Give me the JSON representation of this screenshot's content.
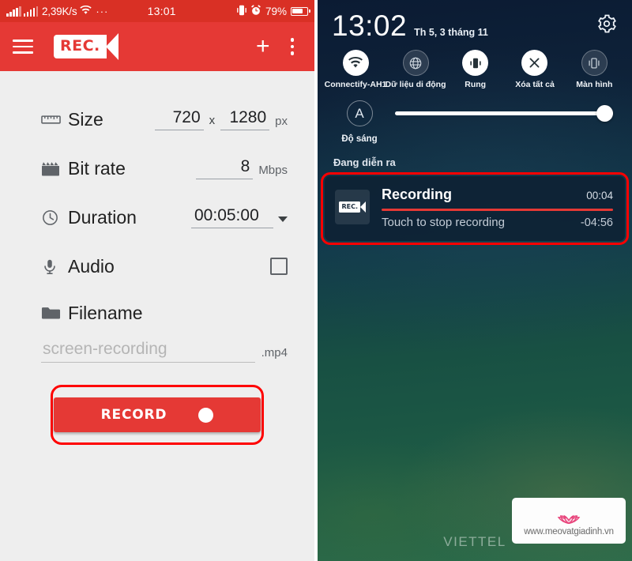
{
  "left": {
    "statusbar": {
      "net_speed": "2,39K/s",
      "dots": "···",
      "time": "13:01",
      "battery_pct": "79%"
    },
    "appbar": {
      "logo_text": "REC.",
      "menu_icon": "hamburger-icon",
      "add_icon": "plus-icon",
      "overflow_icon": "kebab-icon"
    },
    "rows": {
      "size": {
        "label": "Size",
        "icon": "ruler-icon",
        "width": "720",
        "separator": "x",
        "height": "1280",
        "unit": "px"
      },
      "bitrate": {
        "label": "Bit rate",
        "icon": "clapperboard-icon",
        "value": "8",
        "unit": "Mbps"
      },
      "duration": {
        "label": "Duration",
        "icon": "clock-icon",
        "value": "00:05:00",
        "caret": "chevron-down-icon"
      },
      "audio": {
        "label": "Audio",
        "icon": "microphone-icon",
        "checked": false
      },
      "filename": {
        "label": "Filename",
        "icon": "folder-icon",
        "placeholder": "screen-recording",
        "extension": ".mp4"
      }
    },
    "record_button": {
      "label": "RECORD",
      "dot": "record-dot-icon"
    }
  },
  "right": {
    "clock": "13:02",
    "date": "Th 5, 3 tháng 11",
    "settings_icon": "gear-icon",
    "toggles": [
      {
        "label": "Connectify-AH1",
        "icon": "wifi-icon",
        "active": true
      },
      {
        "label": "Dữ liệu di động",
        "icon": "globe-icon",
        "active": false
      },
      {
        "label": "Rung",
        "icon": "vibrate-icon",
        "active": true
      },
      {
        "label": "Xóa tất cả",
        "icon": "clear-all-icon",
        "active": true
      },
      {
        "label": "Màn hình",
        "icon": "screen-rotate-icon",
        "active": false
      }
    ],
    "brightness": {
      "auto_glyph": "A",
      "label": "Độ sáng",
      "value_pct": 97
    },
    "section_label": "Đang diễn ra",
    "notification": {
      "icon": "rec-app-icon",
      "icon_text": "REC.",
      "title": "Recording",
      "elapsed": "00:04",
      "subtitle": "Touch to stop recording",
      "remaining": "-04:56"
    },
    "carrier": "VIETTEL",
    "watermark": {
      "url": "www.meovatgiadinh.vn",
      "logo": "lotus-icon"
    }
  },
  "colors": {
    "accent_red": "#e53935",
    "statusbar_red": "#d93025",
    "annotation_red": "#ff0000",
    "panel_bg": "#eeeeee"
  }
}
